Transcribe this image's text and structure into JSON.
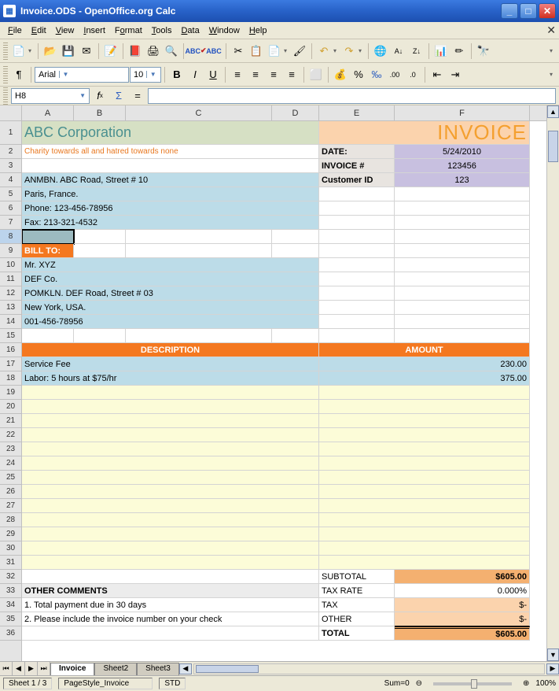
{
  "window": {
    "title": "Invoice.ODS - OpenOffice.org Calc"
  },
  "menus": [
    "File",
    "Edit",
    "View",
    "Insert",
    "Format",
    "Tools",
    "Data",
    "Window",
    "Help"
  ],
  "format": {
    "font_name": "Arial",
    "font_size": "10"
  },
  "name_box": "H8",
  "formula": "",
  "columns": [
    "A",
    "B",
    "C",
    "D",
    "E",
    "F"
  ],
  "invoice": {
    "company": "ABC Corporation",
    "tagline": "Charity towards all and hatred towards none",
    "title": "INVOICE",
    "date_label": "DATE:",
    "date_value": "5/24/2010",
    "inv_label": "INVOICE #",
    "inv_value": "123456",
    "cust_label": "Customer ID",
    "cust_value": "123",
    "addr1": "ANMBN. ABC Road, Street # 10",
    "addr2": "Paris, France.",
    "addr3": "Phone: 123-456-78956",
    "addr4": "Fax: 213-321-4532",
    "billto_label": "BILL TO:",
    "bill1": "Mr. XYZ",
    "bill2": "DEF Co.",
    "bill3": "POMKLN. DEF Road, Street # 03",
    "bill4": "New York, USA.",
    "bill5": "001-456-78956",
    "desc_hdr": "DESCRIPTION",
    "amt_hdr": "AMOUNT",
    "line1_desc": "Service Fee",
    "line1_amt": "230.00",
    "line2_desc": "Labor: 5 hours at $75/hr",
    "line2_amt": "375.00",
    "subtotal_label": "SUBTOTAL",
    "subtotal_value": "$605.00",
    "taxrate_label": "TAX RATE",
    "taxrate_value": "0.000%",
    "tax_label": "TAX",
    "tax_value": "$-",
    "other_label": "OTHER",
    "other_value": "$-",
    "total_label": "TOTAL",
    "total_value": "$605.00",
    "comments_hdr": "OTHER COMMENTS",
    "comment1": "1. Total payment due in 30 days",
    "comment2": "2. Please include the invoice number on your check"
  },
  "tabs": [
    "Invoice",
    "Sheet2",
    "Sheet3"
  ],
  "status": {
    "sheet": "Sheet 1 / 3",
    "style": "PageStyle_Invoice",
    "mode": "STD",
    "sum": "Sum=0",
    "zoom": "100%"
  }
}
